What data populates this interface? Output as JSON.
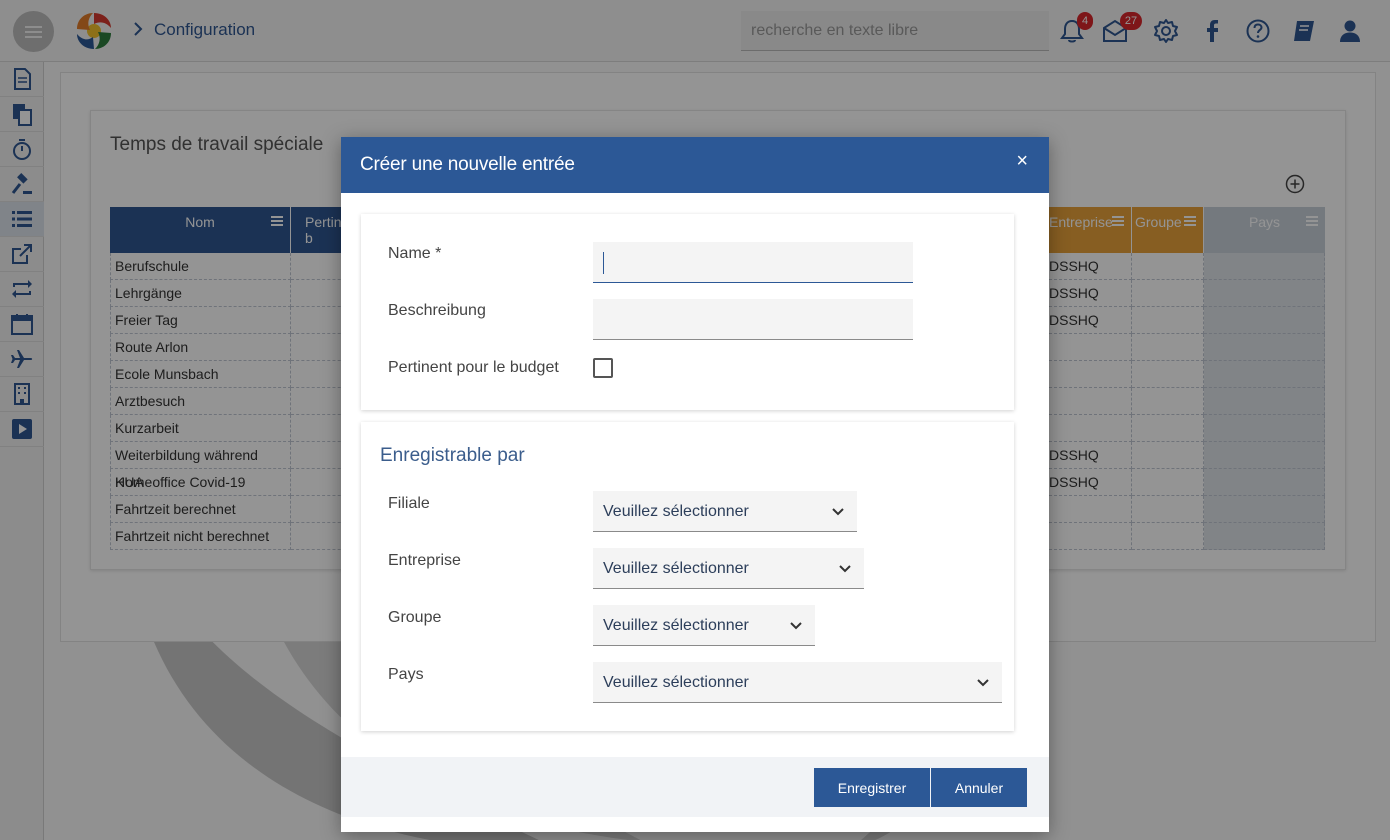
{
  "header": {
    "breadcrumb": "Configuration",
    "search_placeholder": "recherche en texte libre",
    "notifications_count": "4",
    "messages_count": "27"
  },
  "page": {
    "card_title": "Temps de travail spéciale",
    "columns": [
      "Nom",
      "Pertin b",
      "Entreprise",
      "Groupe",
      "Pays"
    ],
    "rows": [
      {
        "nom": "Berufschule",
        "entreprise": "DSSHQ"
      },
      {
        "nom": "Lehrgänge",
        "entreprise": "DSSHQ"
      },
      {
        "nom": "Freier Tag",
        "entreprise": "DSSHQ"
      },
      {
        "nom": "Route Arlon",
        "entreprise": ""
      },
      {
        "nom": "Ecole Munsbach",
        "entreprise": ""
      },
      {
        "nom": "Arztbesuch",
        "entreprise": ""
      },
      {
        "nom": "Kurzarbeit",
        "entreprise": ""
      },
      {
        "nom": "Weiterbildung während KUA",
        "entreprise": "DSSHQ"
      },
      {
        "nom": "Homeoffice Covid-19",
        "entreprise": "DSSHQ"
      },
      {
        "nom": "Fahrtzeit berechnet",
        "entreprise": ""
      },
      {
        "nom": "Fahrtzeit nicht berechnet",
        "entreprise": ""
      }
    ]
  },
  "modal": {
    "title": "Créer une nouvelle entrée",
    "close_glyph": "×",
    "name_label": "Name *",
    "name_value": "",
    "description_label": "Beschreibung",
    "description_value": "",
    "budget_label": "Pertinent pour le budget",
    "budget_checked": false,
    "section_title": "Enregistrable par",
    "filiale_label": "Filiale",
    "filiale_value": "Veuillez sélectionner",
    "entreprise_label": "Entreprise",
    "entreprise_value": "Veuillez sélectionner",
    "groupe_label": "Groupe",
    "groupe_value": "Veuillez sélectionner",
    "pays_label": "Pays",
    "pays_value": "Veuillez sélectionner",
    "save_label": "Enregistrer",
    "cancel_label": "Annuler"
  },
  "colors": {
    "brand_blue": "#2c5896",
    "table_header_blue": "#2f5792",
    "table_header_orange": "#e8a23c",
    "badge_red": "#d9262c"
  }
}
